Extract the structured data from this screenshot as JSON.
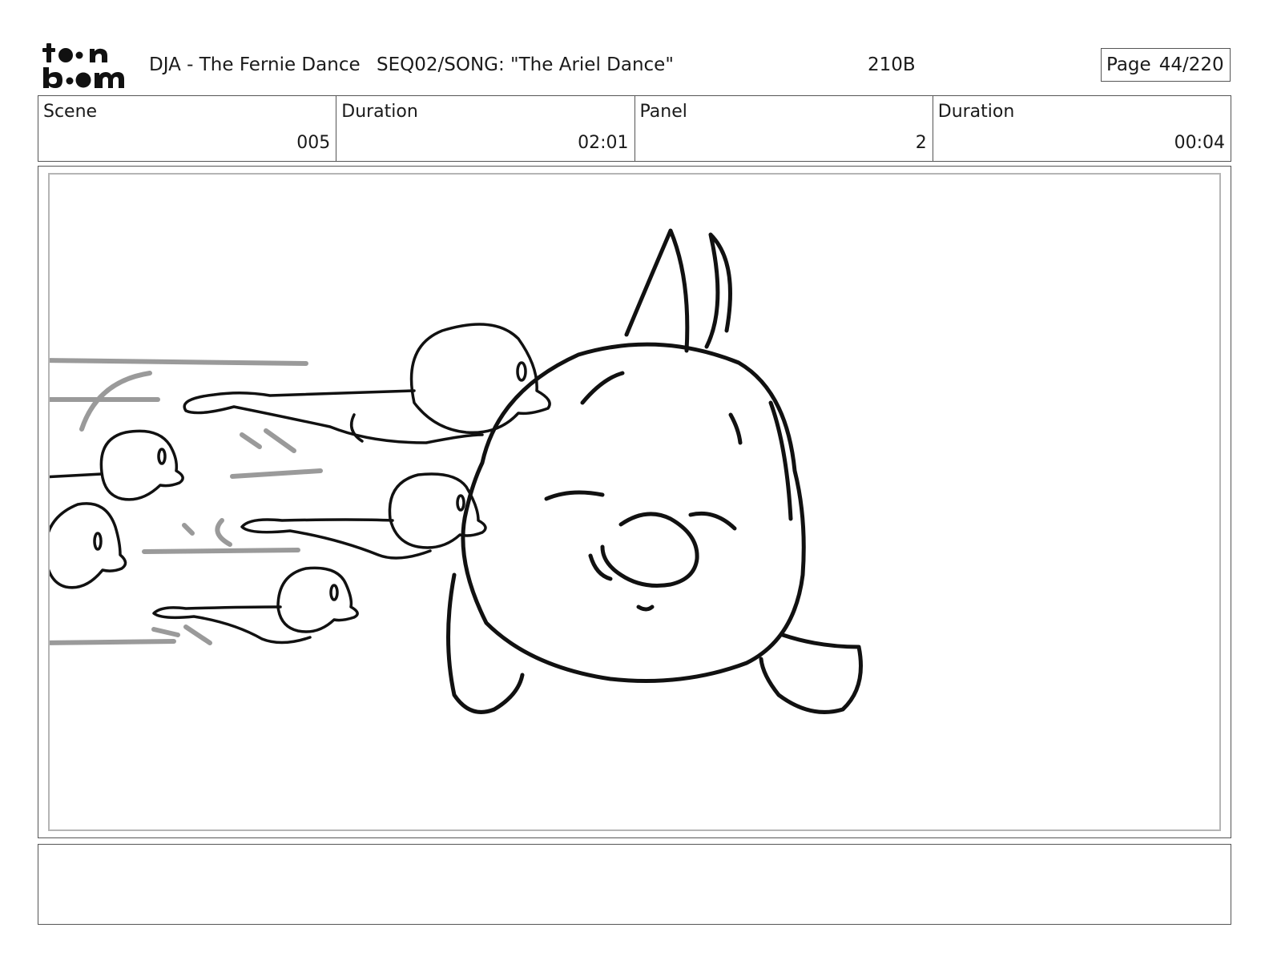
{
  "header": {
    "logo_text": "toon boom",
    "project": "DJA - The Fernie Dance",
    "sequence": "SEQ02/SONG: \"The Ariel Dance\"",
    "code": "210B",
    "page_label": "Page",
    "page_number": "44/220"
  },
  "info": {
    "scene_label": "Scene",
    "scene_value": "005",
    "scene_duration_label": "Duration",
    "scene_duration_value": "02:01",
    "panel_label": "Panel",
    "panel_value": "2",
    "panel_duration_label": "Duration",
    "panel_duration_value": "00:04"
  },
  "drawing": {
    "description_icon": "storyboard-sketch"
  },
  "notes": {
    "text": ""
  }
}
